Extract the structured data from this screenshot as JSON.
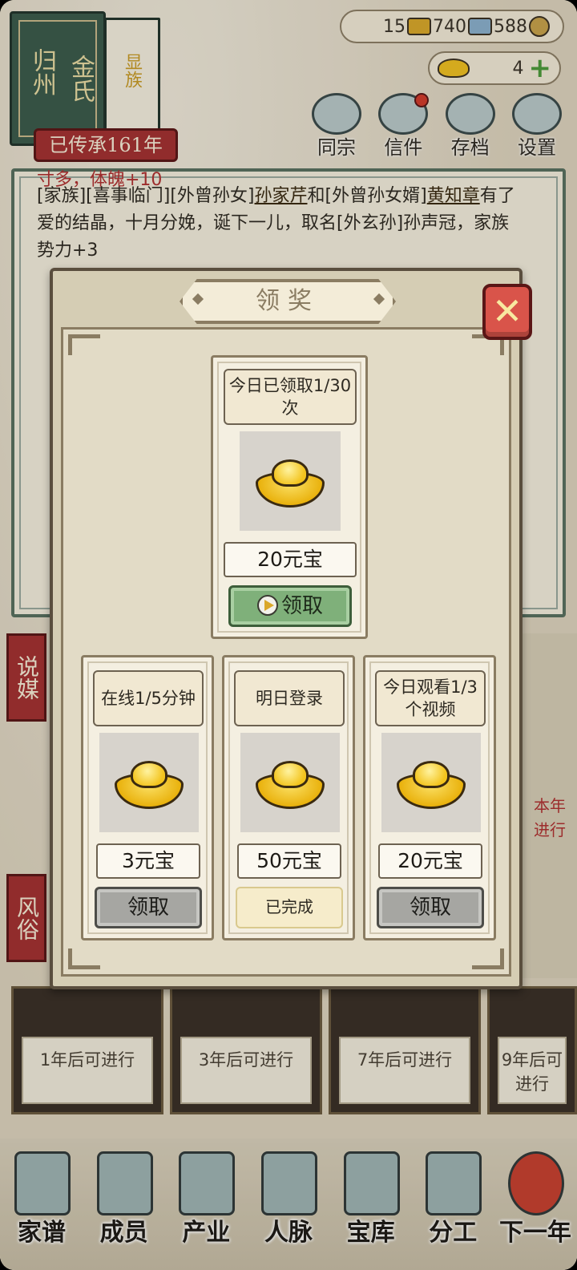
{
  "clan": {
    "book_title_1": "归州",
    "book_title_2": "金氏",
    "book_tag": "显族",
    "inherit_label": "已传承161年"
  },
  "resources": {
    "gold": "15",
    "silver": "740",
    "coins": "588",
    "ingots": "4"
  },
  "top_nav": [
    {
      "label": "同宗"
    },
    {
      "label": "信件"
    },
    {
      "label": "存档"
    },
    {
      "label": "设置"
    }
  ],
  "log": {
    "partial_line": "寸多，体魄+10",
    "line_1a": "[家族][喜事临门][外曾孙女]",
    "name_1": "孙家芹",
    "line_1b": "和[外曾孙女婿]",
    "name_2": "黄知章",
    "line_1c": "有了爱的结晶，十月分娩，诞下一儿，取名[外玄孙]孙声冠，家族势力+3"
  },
  "side_tabs": [
    {
      "label": "说媒"
    },
    {
      "label": "风俗"
    }
  ],
  "right_strip": {
    "text": "本年进行"
  },
  "bottom_cards": [
    {
      "label": "1年后可进行"
    },
    {
      "label": "3年后可进行"
    },
    {
      "label": "7年后可进行"
    },
    {
      "label": "9年后可进行"
    }
  ],
  "bottom_nav": [
    {
      "label": "家谱"
    },
    {
      "label": "成员"
    },
    {
      "label": "产业"
    },
    {
      "label": "人脉"
    },
    {
      "label": "宝库"
    },
    {
      "label": "分工"
    },
    {
      "label": "下一年"
    }
  ],
  "modal": {
    "title": "领奖",
    "close_icon": "close-x",
    "featured": {
      "condition": "今日已领取1/30次",
      "reward": "20元宝",
      "button": "领取"
    },
    "rewards": [
      {
        "condition": "在线1/5分钟",
        "reward": "3元宝",
        "button": "领取",
        "state": "locked"
      },
      {
        "condition": "明日登录",
        "reward": "50元宝",
        "button": "已完成",
        "state": "done"
      },
      {
        "condition": "今日观看1/3个视频",
        "reward": "20元宝",
        "button": "领取",
        "state": "locked"
      }
    ]
  },
  "colors": {
    "accent_red": "#a33030",
    "claim_green": "#7fb07a",
    "locked_gray": "#a6a6a2",
    "ingot_gold": "#f0c020"
  }
}
